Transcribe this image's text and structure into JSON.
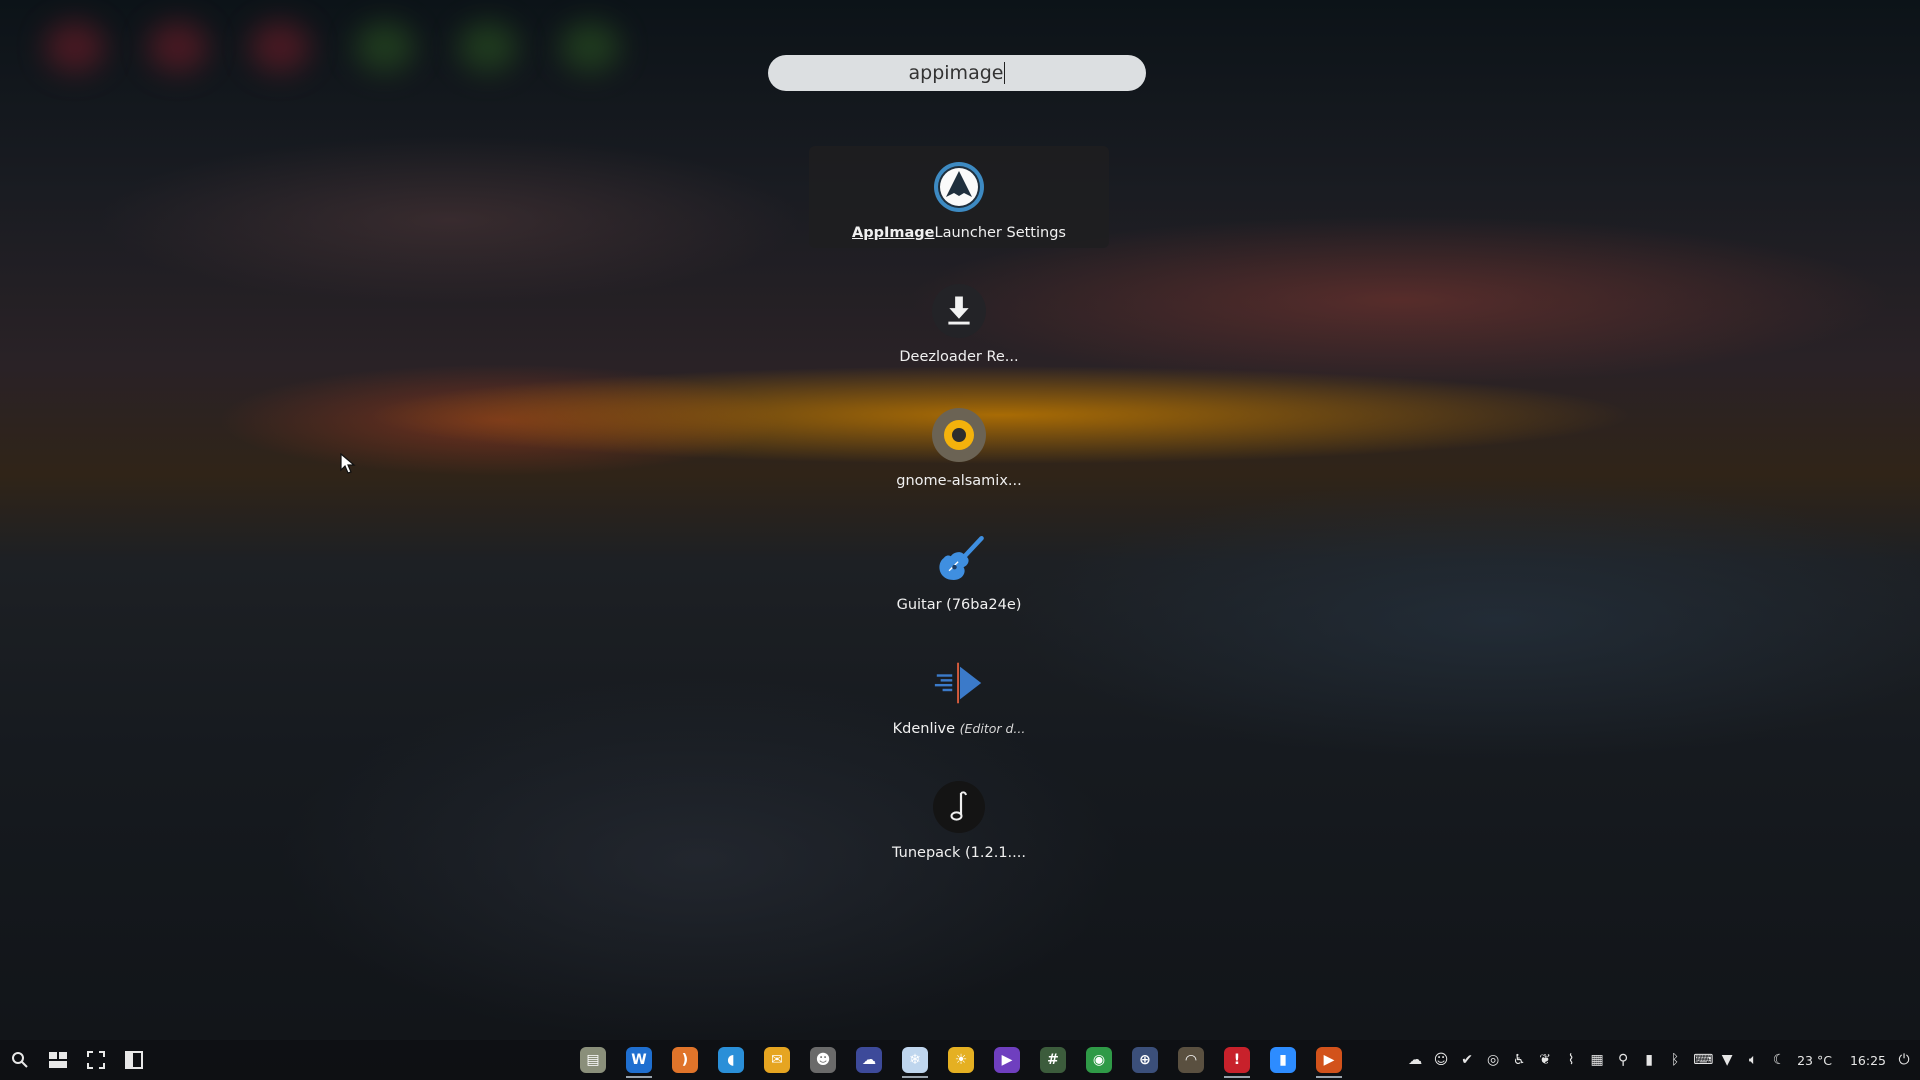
{
  "search": {
    "query": "appimage"
  },
  "results": [
    {
      "bold": "AppImage",
      "rest": "Launcher Settings",
      "icon": "appimage-launcher-icon",
      "selected": true
    },
    {
      "bold": "",
      "rest": "Deezloader Re...",
      "icon": "download-icon"
    },
    {
      "bold": "",
      "rest": "gnome-alsamix...",
      "icon": "alsamixer-icon"
    },
    {
      "bold": "",
      "rest": "Guitar (76ba24e)",
      "icon": "guitar-icon"
    },
    {
      "bold": "",
      "rest": "Kdenlive ",
      "italic": "(Editor d...",
      "icon": "kdenlive-icon"
    },
    {
      "bold": "",
      "rest": "Tunepack (1.2.1....",
      "icon": "music-note-icon"
    }
  ],
  "taskbar": {
    "left_icons": [
      "search-icon",
      "windows-icon",
      "fullscreen-icon",
      "panel-icon"
    ],
    "apps": [
      {
        "icon": "files-icon",
        "color": "#8a8f7a",
        "glyph": "▤"
      },
      {
        "icon": "writer-icon",
        "color": "#1f6fd0",
        "glyph": "W",
        "active": true
      },
      {
        "icon": "rss-icon",
        "color": "#e0742a",
        "glyph": ")"
      },
      {
        "icon": "chat-icon",
        "color": "#2a8fd8",
        "glyph": "◖"
      },
      {
        "icon": "mail-icon",
        "color": "#e6a521",
        "glyph": "✉"
      },
      {
        "icon": "gnu-icon",
        "color": "#6a6a6a",
        "glyph": "☻"
      },
      {
        "icon": "cloud-icon",
        "color": "#3d4a9a",
        "glyph": "☁"
      },
      {
        "icon": "snowflake-icon",
        "color": "#bfd6ee",
        "glyph": "❄",
        "active": true
      },
      {
        "icon": "weather-icon",
        "color": "#e5b022",
        "glyph": "☀"
      },
      {
        "icon": "video-icon",
        "color": "#6f3fbf",
        "glyph": "▶"
      },
      {
        "icon": "calculator-icon",
        "color": "#3c5c3c",
        "glyph": "#"
      },
      {
        "icon": "browser-icon",
        "color": "#2f9a47",
        "glyph": "◉"
      },
      {
        "icon": "globe-icon",
        "color": "#3b4f7a",
        "glyph": "⊕"
      },
      {
        "icon": "gimp-icon",
        "color": "#5a5040",
        "glyph": "◠"
      },
      {
        "icon": "app-red-icon",
        "color": "#c8212b",
        "glyph": "!",
        "active": true
      },
      {
        "icon": "zoom-icon",
        "color": "#2d8cff",
        "glyph": "▮"
      },
      {
        "icon": "app-orange-icon",
        "color": "#d2521b",
        "glyph": "▶",
        "active": true
      }
    ],
    "tray": {
      "weather": "23 °C",
      "clock": "16:25"
    }
  }
}
